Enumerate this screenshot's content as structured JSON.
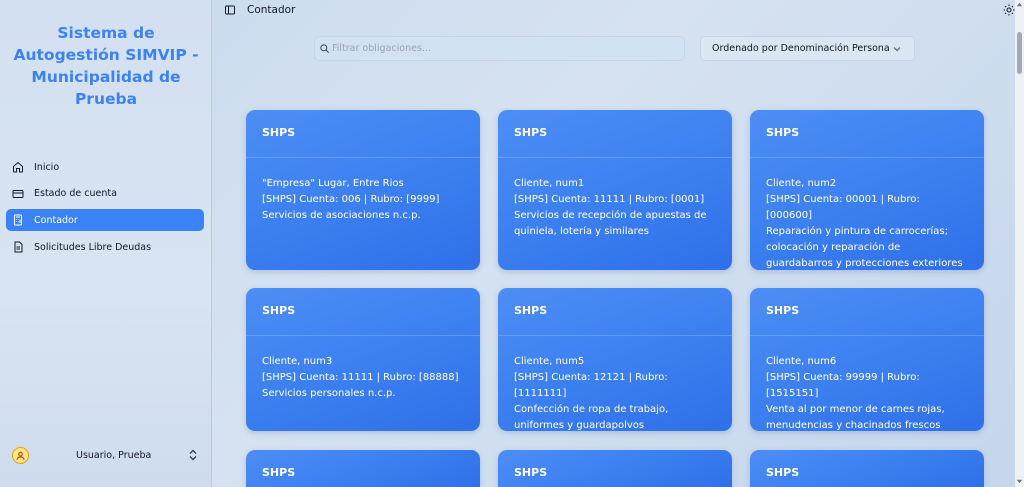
{
  "sidebar": {
    "brand": "Sistema de Autogestión SIMVIP - Municipalidad de Prueba",
    "items": [
      {
        "label": "Inicio",
        "icon": "home-icon"
      },
      {
        "label": "Estado de cuenta",
        "icon": "credit-card-icon"
      },
      {
        "label": "Contador",
        "icon": "calculator-icon",
        "active": true
      },
      {
        "label": "Solicitudes Libre Deudas",
        "icon": "document-icon"
      }
    ],
    "user": "Usuario, Prueba"
  },
  "header": {
    "title": "Contador"
  },
  "search": {
    "placeholder": "Filtrar obligaciones..."
  },
  "sort": {
    "label": "Ordenado por Denominación Persona"
  },
  "cards": [
    {
      "title": "SHPS",
      "line1": "\"Empresa\" Lugar, Entre Rios",
      "line2": "[SHPS] Cuenta: 006 | Rubro: [9999]",
      "line3": "Servicios de asociaciones n.c.p."
    },
    {
      "title": "SHPS",
      "line1": "Cliente, num1",
      "line2": "[SHPS] Cuenta: 11111 | Rubro: [0001]",
      "line3": "Servicios de recepción de apuestas de quiniela, lotería y similares"
    },
    {
      "title": "SHPS",
      "line1": "Cliente, num2",
      "line2": "[SHPS] Cuenta: 00001 | Rubro: [000600]",
      "line3": "Reparación y pintura de carrocerías; colocación y reparación de guardabarros y protecciones exteriores"
    },
    {
      "title": "SHPS",
      "line1": "Cliente, num3",
      "line2": "[SHPS] Cuenta: 11111 | Rubro: [88888]",
      "line3": "Servicios personales n.c.p."
    },
    {
      "title": "SHPS",
      "line1": "Cliente, num5",
      "line2": "[SHPS] Cuenta: 12121 | Rubro: [1111111]",
      "line3": "Confección de ropa de trabajo, uniformes y guardapolvos"
    },
    {
      "title": "SHPS",
      "line1": "Cliente, num6",
      "line2": "[SHPS] Cuenta: 99999 | Rubro: [1515151]",
      "line3": "Venta al por menor de carnes rojas, menudencias y chacinados frescos"
    },
    {
      "title": "SHPS"
    },
    {
      "title": "SHPS"
    },
    {
      "title": "SHPS"
    }
  ],
  "colors": {
    "accent": "#3b82f6",
    "card": "#3b7ff0"
  }
}
